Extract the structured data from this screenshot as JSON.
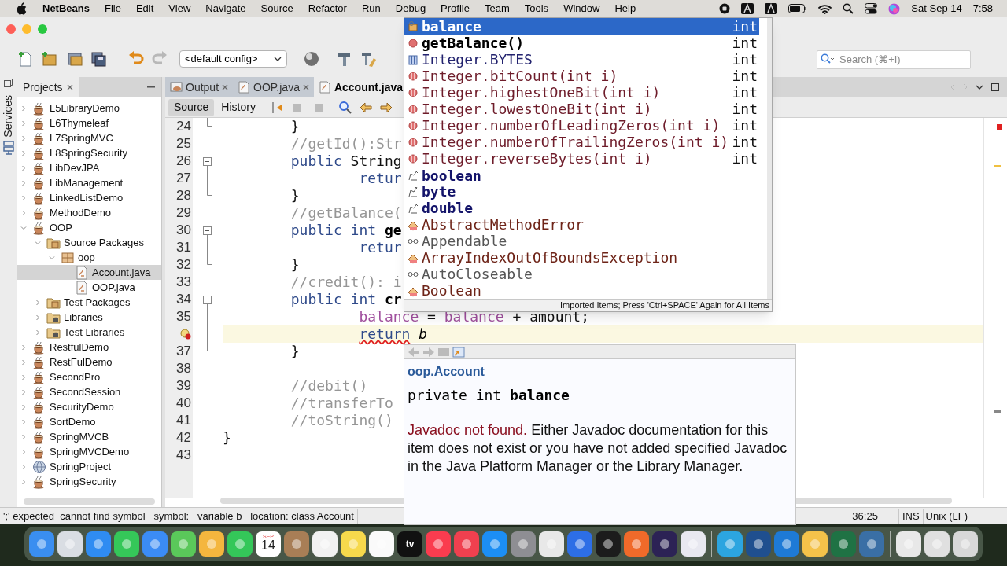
{
  "menu_bar": {
    "app": "NetBeans",
    "items": [
      "File",
      "Edit",
      "View",
      "Navigate",
      "Source",
      "Refactor",
      "Run",
      "Debug",
      "Profile",
      "Team",
      "Tools",
      "Window",
      "Help"
    ],
    "date": "Sat Sep 14",
    "time": "7:58"
  },
  "toolbar": {
    "config": "<default config>",
    "search": {
      "placeholder": "Search (⌘+I)"
    }
  },
  "services_tab": "Services",
  "projects": {
    "title": "Projects",
    "items": [
      {
        "label": "L5LibraryDemo",
        "kind": "project",
        "expanded": false,
        "selected": false
      },
      {
        "label": "L6Thymeleaf",
        "kind": "project",
        "expanded": false,
        "selected": false
      },
      {
        "label": "L7SpringMVC",
        "kind": "project",
        "expanded": false,
        "selected": false
      },
      {
        "label": "L8SpringSecurity",
        "kind": "project",
        "expanded": false,
        "selected": false
      },
      {
        "label": "LibDevJPA",
        "kind": "project",
        "expanded": false,
        "selected": false
      },
      {
        "label": "LibManagement",
        "kind": "project",
        "expanded": false,
        "selected": false
      },
      {
        "label": "LinkedListDemo",
        "kind": "project",
        "expanded": false,
        "selected": false
      },
      {
        "label": "MethodDemo",
        "kind": "project",
        "expanded": false,
        "selected": false
      },
      {
        "label": "OOP",
        "kind": "project",
        "expanded": true,
        "selected": false,
        "children": [
          {
            "label": "Source Packages",
            "kind": "source-folder",
            "expanded": true,
            "selected": false,
            "children": [
              {
                "label": "oop",
                "kind": "package",
                "expanded": true,
                "selected": false,
                "children": [
                  {
                    "label": "Account.java",
                    "kind": "java-file",
                    "selected": true
                  },
                  {
                    "label": "OOP.java",
                    "kind": "java-file",
                    "selected": false
                  }
                ]
              }
            ]
          },
          {
            "label": "Test Packages",
            "kind": "source-folder",
            "expanded": false,
            "selected": false
          },
          {
            "label": "Libraries",
            "kind": "library-folder",
            "expanded": false,
            "selected": false
          },
          {
            "label": "Test Libraries",
            "kind": "library-folder",
            "expanded": false,
            "selected": false
          }
        ]
      },
      {
        "label": "RestfulDemo",
        "kind": "project",
        "expanded": false,
        "selected": false
      },
      {
        "label": "RestFulDemo",
        "kind": "project",
        "expanded": false,
        "selected": false
      },
      {
        "label": "SecondPro",
        "kind": "project",
        "expanded": false,
        "selected": false
      },
      {
        "label": "SecondSession",
        "kind": "project",
        "expanded": false,
        "selected": false
      },
      {
        "label": "SecurityDemo",
        "kind": "project",
        "expanded": false,
        "selected": false
      },
      {
        "label": "SortDemo",
        "kind": "project",
        "expanded": false,
        "selected": false
      },
      {
        "label": "SpringMVCB",
        "kind": "project",
        "expanded": false,
        "selected": false
      },
      {
        "label": "SpringMVCDemo",
        "kind": "project",
        "expanded": false,
        "selected": false
      },
      {
        "label": "SpringProject",
        "kind": "web-project",
        "expanded": false,
        "selected": false
      },
      {
        "label": "SpringSecurity",
        "kind": "project",
        "expanded": false,
        "selected": false
      }
    ]
  },
  "editor_tabs": [
    {
      "label": "Output",
      "kind": "output",
      "selected": false
    },
    {
      "label": "OOP.java",
      "kind": "file",
      "selected": false
    },
    {
      "label": "Account.java",
      "kind": "file",
      "selected": true
    }
  ],
  "editor_views": [
    {
      "label": "Source",
      "selected": true
    },
    {
      "label": "History",
      "selected": false
    }
  ],
  "code": [
    {
      "number": "24",
      "kind": "fold-end",
      "error": false,
      "current": false,
      "segments": [
        {
          "text": "        }",
          "kind": "plain"
        }
      ]
    },
    {
      "number": "25",
      "kind": "plain",
      "error": false,
      "current": false,
      "segments": [
        {
          "text": "        //getId():Str",
          "kind": "comment"
        }
      ]
    },
    {
      "number": "26",
      "kind": "fold-start",
      "error": false,
      "current": false,
      "segments": [
        {
          "text": "        public",
          "kind": "keyword"
        },
        {
          "text": " String",
          "kind": "plain"
        }
      ]
    },
    {
      "number": "27",
      "kind": "fold-inside",
      "error": false,
      "current": false,
      "segments": [
        {
          "text": "                retur",
          "kind": "keyword"
        }
      ]
    },
    {
      "number": "28",
      "kind": "fold-end",
      "error": false,
      "current": false,
      "segments": [
        {
          "text": "        }",
          "kind": "plain"
        }
      ]
    },
    {
      "number": "29",
      "kind": "plain",
      "error": false,
      "current": false,
      "segments": [
        {
          "text": "        //getBalance(",
          "kind": "comment"
        }
      ]
    },
    {
      "number": "30",
      "kind": "fold-start",
      "error": false,
      "current": false,
      "segments": [
        {
          "text": "        public int",
          "kind": "keyword"
        },
        {
          "text": " ge",
          "kind": "bold"
        }
      ]
    },
    {
      "number": "31",
      "kind": "fold-inside",
      "error": false,
      "current": false,
      "segments": [
        {
          "text": "                retur",
          "kind": "keyword"
        }
      ]
    },
    {
      "number": "32",
      "kind": "fold-end",
      "error": false,
      "current": false,
      "segments": [
        {
          "text": "        }",
          "kind": "plain"
        }
      ]
    },
    {
      "number": "33",
      "kind": "plain",
      "error": false,
      "current": false,
      "segments": [
        {
          "text": "        //credit(): i",
          "kind": "comment"
        }
      ]
    },
    {
      "number": "34",
      "kind": "fold-start",
      "error": false,
      "current": false,
      "segments": [
        {
          "text": "        public int",
          "kind": "keyword"
        },
        {
          "text": " cr",
          "kind": "bold"
        }
      ]
    },
    {
      "number": "35",
      "kind": "fold-inside",
      "error": false,
      "current": false,
      "segments": [
        {
          "text": "                balance",
          "kind": "field"
        },
        {
          "text": " = ",
          "kind": "plain"
        },
        {
          "text": "balance",
          "kind": "field"
        },
        {
          "text": " + amount;",
          "kind": "plain"
        }
      ]
    },
    {
      "kind": "fold-inside",
      "error": true,
      "current": true,
      "segments": [
        {
          "text": "                return",
          "kind": "error"
        },
        {
          "text": " b",
          "kind": "italic"
        }
      ]
    },
    {
      "number": "37",
      "kind": "fold-end",
      "error": false,
      "current": false,
      "segments": [
        {
          "text": "        }",
          "kind": "plain"
        }
      ]
    },
    {
      "number": "38",
      "kind": "plain",
      "error": false,
      "current": false
    },
    {
      "number": "39",
      "kind": "plain",
      "error": false,
      "current": false,
      "segments": [
        {
          "text": "        //debit()",
          "kind": "comment"
        }
      ]
    },
    {
      "number": "40",
      "kind": "plain",
      "error": false,
      "current": false,
      "segments": [
        {
          "text": "        //transferTo",
          "kind": "comment"
        }
      ]
    },
    {
      "number": "41",
      "kind": "plain",
      "error": false,
      "current": false,
      "segments": [
        {
          "text": "        //toString()",
          "kind": "comment"
        }
      ]
    },
    {
      "number": "42",
      "kind": "plain",
      "error": false,
      "current": false,
      "segments": [
        {
          "text": "}",
          "kind": "plain"
        }
      ]
    },
    {
      "number": "43",
      "kind": "plain",
      "error": false,
      "current": false
    }
  ],
  "completion": {
    "items": [
      {
        "text": "balance",
        "type": "int",
        "kind": "field",
        "selected": true
      },
      {
        "text": "getBalance()",
        "type": "int",
        "kind": "method",
        "selected": false
      },
      {
        "text": "Integer.BYTES",
        "type": "int",
        "kind": "constant",
        "selected": false
      },
      {
        "text": "Integer.bitCount(int i)",
        "type": "int",
        "kind": "static-method",
        "selected": false
      },
      {
        "text": "Integer.highestOneBit(int i)",
        "type": "int",
        "kind": "static-method",
        "selected": false
      },
      {
        "text": "Integer.lowestOneBit(int i)",
        "type": "int",
        "kind": "static-method",
        "selected": false
      },
      {
        "text": "Integer.numberOfLeadingZeros(int i)",
        "type": "int",
        "kind": "static-method",
        "selected": false
      },
      {
        "text": "Integer.numberOfTrailingZeros(int i)",
        "type": "int",
        "kind": "static-method",
        "selected": false
      },
      {
        "text": "Integer.reverseBytes(int i)",
        "type": "int",
        "kind": "static-method",
        "selected": false
      },
      {
        "text": "boolean",
        "kind": "keyword",
        "selected": false
      },
      {
        "text": "byte",
        "kind": "keyword",
        "selected": false
      },
      {
        "text": "double",
        "kind": "keyword",
        "selected": false
      },
      {
        "text": "AbstractMethodError",
        "kind": "class",
        "selected": false
      },
      {
        "text": "Appendable",
        "kind": "interface",
        "selected": false
      },
      {
        "text": "ArrayIndexOutOfBoundsException",
        "kind": "class",
        "selected": false
      },
      {
        "text": "AutoCloseable",
        "kind": "interface",
        "selected": false
      },
      {
        "text": "Boolean",
        "kind": "class",
        "selected": false
      }
    ],
    "footer": "Imported Items; Press 'Ctrl+SPACE' Again for All Items"
  },
  "javadoc": {
    "link": "oop.Account",
    "signature": "private int **balance**",
    "notice": "Javadoc not found.",
    "message": "Either Javadoc documentation for this item does not exist or you have not added specified Javadoc in the Java Platform Manager or the Library Manager."
  },
  "status_bar": {
    "message": "';' expected  cannot find symbol   symbol:   variable b   location: class Account",
    "position": "36:25",
    "mode": "INS",
    "line_endings": "Unix (LF)"
  },
  "dock": [
    {
      "kind": "app",
      "color": "#3a8ef0"
    },
    {
      "kind": "app",
      "color": "#d9dde3"
    },
    {
      "kind": "app",
      "color": "#2f8cf2"
    },
    {
      "kind": "app",
      "color": "#35c759"
    },
    {
      "kind": "app",
      "color": "#3b8cf5"
    },
    {
      "kind": "app",
      "color": "#5ac85a"
    },
    {
      "kind": "app",
      "color": "#f4b63e"
    },
    {
      "kind": "app",
      "color": "#34c759"
    },
    {
      "kind": "calendar",
      "month": "SEP",
      "day": "14"
    },
    {
      "kind": "app",
      "color": "#a87e56"
    },
    {
      "kind": "app",
      "color": "#f2f2f2"
    },
    {
      "kind": "app",
      "color": "#f7d94c"
    },
    {
      "kind": "app",
      "color": "#fafafa"
    },
    {
      "kind": "label",
      "text": "tv"
    },
    {
      "kind": "app",
      "color": "#fa3c4f"
    },
    {
      "kind": "app",
      "color": "#f0404f"
    },
    {
      "kind": "app",
      "color": "#1c8ef4"
    },
    {
      "kind": "app",
      "color": "#8e8e93"
    },
    {
      "kind": "app",
      "color": "#e8e8e8"
    },
    {
      "kind": "app",
      "color": "#2d6ee6"
    },
    {
      "kind": "app",
      "color": "#1c1c1c"
    },
    {
      "kind": "app",
      "color": "#f06a2a"
    },
    {
      "kind": "app",
      "color": "#2c2255"
    },
    {
      "kind": "app",
      "color": "#e8e8f0"
    },
    {
      "kind": "separator"
    },
    {
      "kind": "app",
      "color": "#2ca5e0"
    },
    {
      "kind": "app",
      "color": "#1f4f8f"
    },
    {
      "kind": "app",
      "color": "#1e7ad6"
    },
    {
      "kind": "app",
      "color": "#f4c24a"
    },
    {
      "kind": "app",
      "color": "#1f7244"
    },
    {
      "kind": "app",
      "color": "#3a6fa5"
    },
    {
      "kind": "separator"
    },
    {
      "kind": "app",
      "color": "#e8e8e8"
    },
    {
      "kind": "app",
      "color": "#e0e0e0"
    },
    {
      "kind": "app",
      "color": "#d8d8d8"
    }
  ]
}
